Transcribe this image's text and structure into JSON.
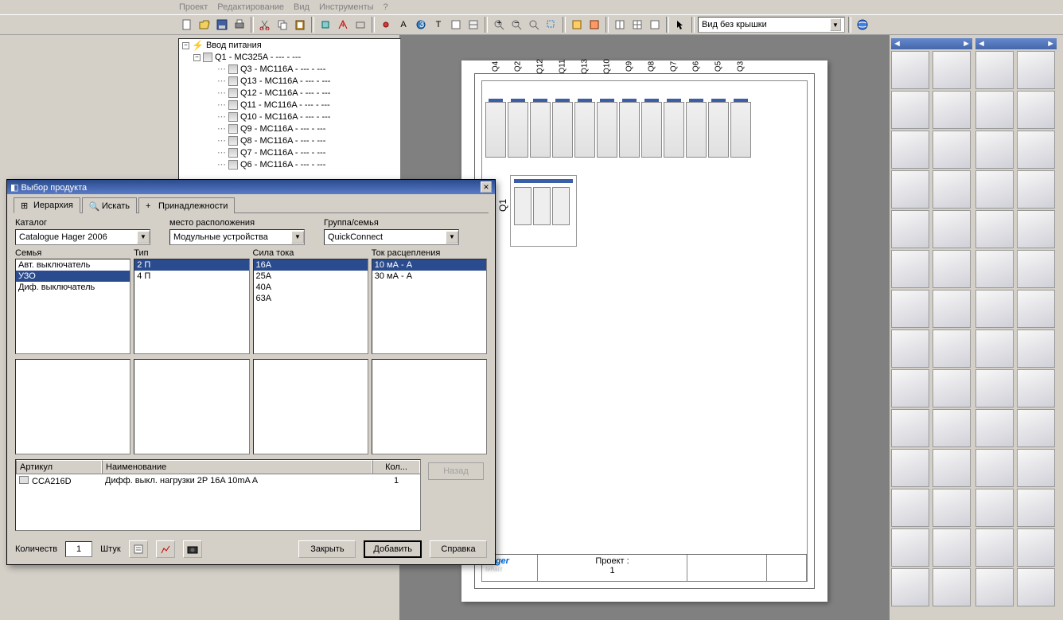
{
  "menu": [
    "Проект",
    "Редактирование",
    "Вид",
    "Инструменты",
    "?"
  ],
  "toolbar_combo": "Вид без крышки",
  "tree": {
    "root": "Ввод питания",
    "q1": "Q1 - MC325A - --- - ---",
    "children": [
      "Q3 - MC116A - --- - ---",
      "Q13 - MC116A - --- - ---",
      "Q12 - MC116A - --- - ---",
      "Q11 - MC116A - --- - ---",
      "Q10 - MC116A - --- - ---",
      "Q9 - MC116A - --- - ---",
      "Q8 - MC116A - --- - ---",
      "Q7 - MC116A - --- - ---",
      "Q6 - MC116A - --- - ---"
    ]
  },
  "schematic": {
    "q1_label": "Q1",
    "row2_labels": [
      "Q4",
      "Q2",
      "Q12",
      "Q11",
      "Q13",
      "Q10",
      "Q9",
      "Q8",
      "Q7",
      "Q6",
      "Q5",
      "Q3"
    ],
    "brand1": "hager",
    "brand2": "tehalit",
    "project_label": "Проект :",
    "project_num": "1"
  },
  "dialog": {
    "title": "Выбор продукта",
    "tabs": [
      {
        "label": "Иерархия",
        "active": true
      },
      {
        "label": "Искать",
        "active": false
      },
      {
        "label": "Принадлежности",
        "active": false
      }
    ],
    "fields": {
      "catalog_label": "Каталог",
      "catalog_value": "Catalogue Hager 2006",
      "location_label": "место расположения",
      "location_value": "Модульные устройства",
      "group_label": "Группа/семья",
      "group_value": "QuickConnect"
    },
    "listboxes": {
      "family": {
        "label": "Семья",
        "items": [
          "Авт. выключатель",
          "УЗО",
          "Диф. выключатель"
        ],
        "selected": 1
      },
      "type": {
        "label": "Тип",
        "items": [
          "2 П",
          "4 П"
        ],
        "selected": 0
      },
      "current": {
        "label": "Сила тока",
        "items": [
          "16A",
          "25A",
          "40A",
          "63A"
        ],
        "selected": 0
      },
      "trip": {
        "label": "Ток расцепления",
        "items": [
          "10 мА - A",
          "30 мА - A"
        ],
        "selected": 0
      }
    },
    "result": {
      "headers": {
        "art": "Артикул",
        "name": "Наименование",
        "qty": "Кол..."
      },
      "row": {
        "art": "CCA216D",
        "name": "Дифф. выкл. нагрузки 2P 16A 10mA A",
        "qty": "1"
      }
    },
    "buttons": {
      "back": "Назад",
      "qty_label": "Количеств",
      "qty_value": "1",
      "units": "Штук",
      "close": "Закрыть",
      "add": "Добавить",
      "help": "Справка"
    }
  }
}
